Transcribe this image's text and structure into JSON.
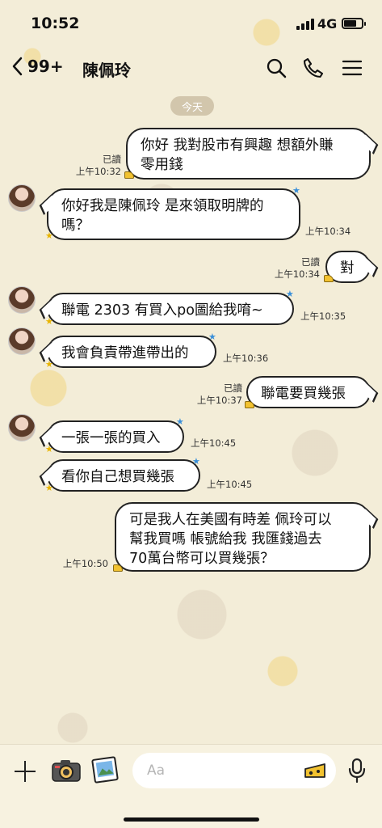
{
  "status": {
    "time": "10:52",
    "network": "4G",
    "battery_level": 0.7
  },
  "header": {
    "back_count": "99+",
    "title": "陳佩玲"
  },
  "date_chip": "今天",
  "messages": [
    {
      "dir": "out",
      "text": "你好 我對股市有興趣 想額外賺\n零用錢",
      "read": "已讀",
      "time": "上午10:32"
    },
    {
      "dir": "in",
      "text": "你好我是陳佩玲 是來領取明牌的\n嗎？",
      "time": "上午10:34"
    },
    {
      "dir": "out",
      "text": "對",
      "read": "已讀",
      "time": "上午10:34"
    },
    {
      "dir": "in",
      "text": "聯電 2303 有買入po圖給我唷~",
      "time": "上午10:35"
    },
    {
      "dir": "in",
      "text": "我會負責帶進帶出的",
      "time": "上午10:36"
    },
    {
      "dir": "out",
      "text": "聯電要買幾張",
      "read": "已讀",
      "time": "上午10:37"
    },
    {
      "dir": "in",
      "text": "一張一張的買入",
      "time": "上午10:45"
    },
    {
      "dir": "in",
      "text": "看你自己想買幾張",
      "time": "上午10:45"
    },
    {
      "dir": "out",
      "text": "可是我人在美國有時差 佩玲可以\n幫我買嗎 帳號給我 我匯錢過去\n70萬台幣可以買幾張？",
      "time": "上午10:50"
    }
  ],
  "input": {
    "placeholder": "Aa"
  },
  "colors": {
    "background": "#f3edd8",
    "bubble": "#ffffff",
    "outline": "#222222"
  }
}
